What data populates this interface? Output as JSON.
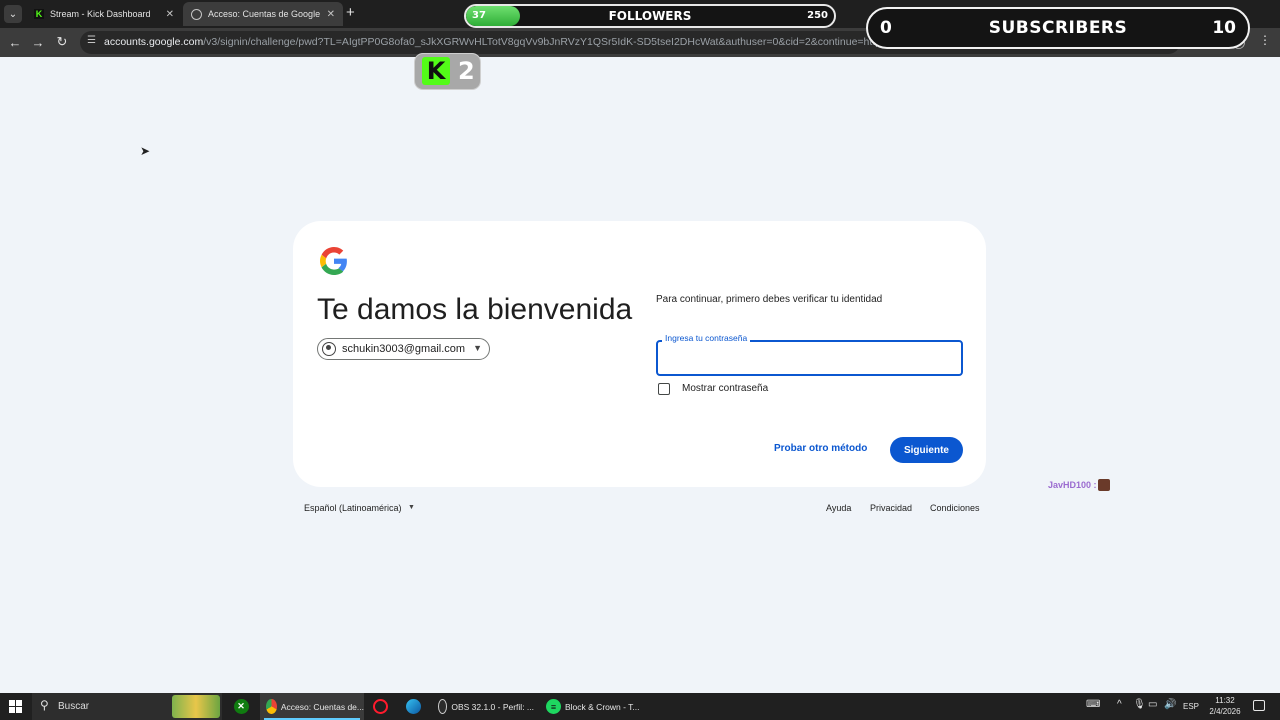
{
  "browser": {
    "tabs": [
      {
        "title": "Stream - Kick Dashboard",
        "favicon": "kick-icon"
      },
      {
        "title": "Acceso: Cuentas de Google",
        "favicon": "globe-icon"
      }
    ],
    "new_tab_symbol": "+",
    "url_host": "accounts.google.com",
    "url_path": "/v3/signin/challenge/pwd?TL=AIgtPP0G8ofa0_sJkXGRWvHLTotV8gqVv9bJnRVzY1QSr5IdK-SD5tseI2DHcWat&authuser=0&cid=2&continue=https%3A%2F%2Fmyaccount.google.com%2Fdevice-activity%3Fgar%3DWzJd%26continue%..."
  },
  "overlay": {
    "followers": {
      "label": "FOLLOWERS",
      "current": "37",
      "goal": "250",
      "progress_fraction": 0.148
    },
    "subscribers": {
      "label": "SUBSCRIBERS",
      "current": "0",
      "goal": "10"
    },
    "kick_count": "2",
    "kick_logo_letter": "K",
    "chat_user": "JavHD100 :"
  },
  "signin": {
    "heading": "Te damos la bienvenida",
    "account_email": "schukin3003@gmail.com",
    "verify_text": "Para continuar, primero debes verificar tu identidad",
    "password_label": "Ingresa tu contraseña",
    "show_password_label": "Mostrar contraseña",
    "other_method_label": "Probar otro método",
    "next_label": "Siguiente"
  },
  "footer": {
    "language": "Español (Latinoamérica)",
    "links": [
      "Ayuda",
      "Privacidad",
      "Condiciones"
    ]
  },
  "taskbar": {
    "search_label": "Buscar",
    "items": [
      {
        "label": "Acceso: Cuentas de...",
        "icon": "chrome-icon"
      },
      {
        "label": "OBS 32.1.0 - Perfil: ...",
        "icon": "obs-icon"
      },
      {
        "label": "Block & Crown - T...",
        "icon": "spotify-icon"
      }
    ],
    "language": "ESP",
    "time": "11:32",
    "date": "2/4/2026"
  },
  "colors": {
    "google_blue": "#0b57d0",
    "kick_green": "#53fc18",
    "page_bg": "#f0f4f9"
  }
}
